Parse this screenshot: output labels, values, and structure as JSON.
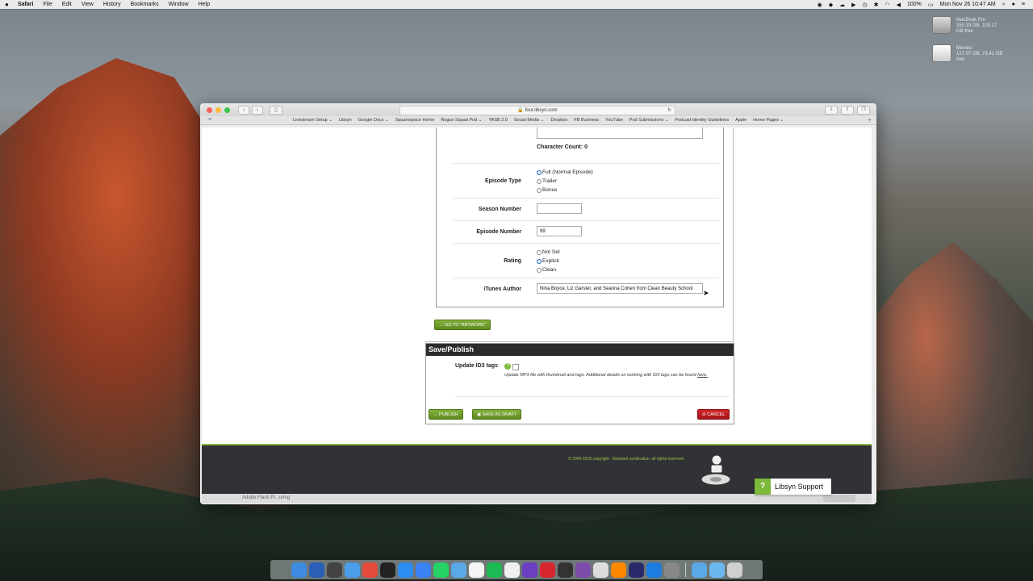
{
  "menubar": {
    "apple": "",
    "items": [
      "Safari",
      "File",
      "Edit",
      "View",
      "History",
      "Bookmarks",
      "Window",
      "Help"
    ],
    "battery": "100%",
    "datetime": "Mon Nov 26  10:47 AM"
  },
  "desktop": {
    "disk1": {
      "name": "MacBook Pro",
      "info": "250.33 GB, 100.17 GB free"
    },
    "disk2": {
      "name": "Movies",
      "info": "127.07 GB, 73.41 GB free"
    }
  },
  "browser": {
    "url": "four.libsyn.com",
    "bookmarks": [
      "Livestream Setup ⌄",
      "Libsyn",
      "Google Docs ⌄",
      "Squarespace Home",
      "Rogue Squad Pod ⌄",
      "YASB 2.0",
      "Social Media ⌄",
      "Dropbox",
      "FB Business",
      "YouTube",
      "Pod Submissions ⌄",
      "Podcast Identity Guidelines",
      "Apple",
      "Home Pages ⌄"
    ],
    "background_tab": "Adobe Flash Pl...uring"
  },
  "form": {
    "character_count": "Character Count: 0",
    "episode_type": {
      "label": "Episode Type",
      "options": [
        "Full (Normal Episode)",
        "Trailer",
        "Bonus"
      ],
      "selected": "Full (Normal Episode)"
    },
    "season_number": {
      "label": "Season Number",
      "value": ""
    },
    "episode_number": {
      "label": "Episode Number",
      "value": "99"
    },
    "rating": {
      "label": "Rating",
      "options": [
        "Not Set",
        "Explicit",
        "Clean"
      ],
      "selected": "Explicit"
    },
    "itunes_author": {
      "label": "iTunes Author",
      "value": "Nina Boyce, Liz Garster, and Seanna Cohen from Clean Beauty School"
    },
    "go_artwork": "→ GO TO \"ARTWORK\""
  },
  "publish": {
    "title": "Save/Publish",
    "id3_label": "Update ID3 tags",
    "help_glyph": "?",
    "id3_note": "Update MP3 file with thumbnail and tags. Additional details on working with ID3 tags can be found",
    "here_link": "here.",
    "publish_btn": "→ PUBLISH",
    "draft_btn": "▣ SAVE AS DRAFT",
    "cancel_btn": "⊘ CANCEL"
  },
  "footer": {
    "copyright": "© 2004-2018 copyright - liberated syndication, all rights reserved"
  },
  "support": {
    "label": "Libsyn Support",
    "icon": "?"
  },
  "colors": {
    "accent_green": "#7cb83a",
    "cancel_red": "#c0191d",
    "header_dark": "#2b2b2b",
    "radio_blue": "#2f7bde"
  }
}
